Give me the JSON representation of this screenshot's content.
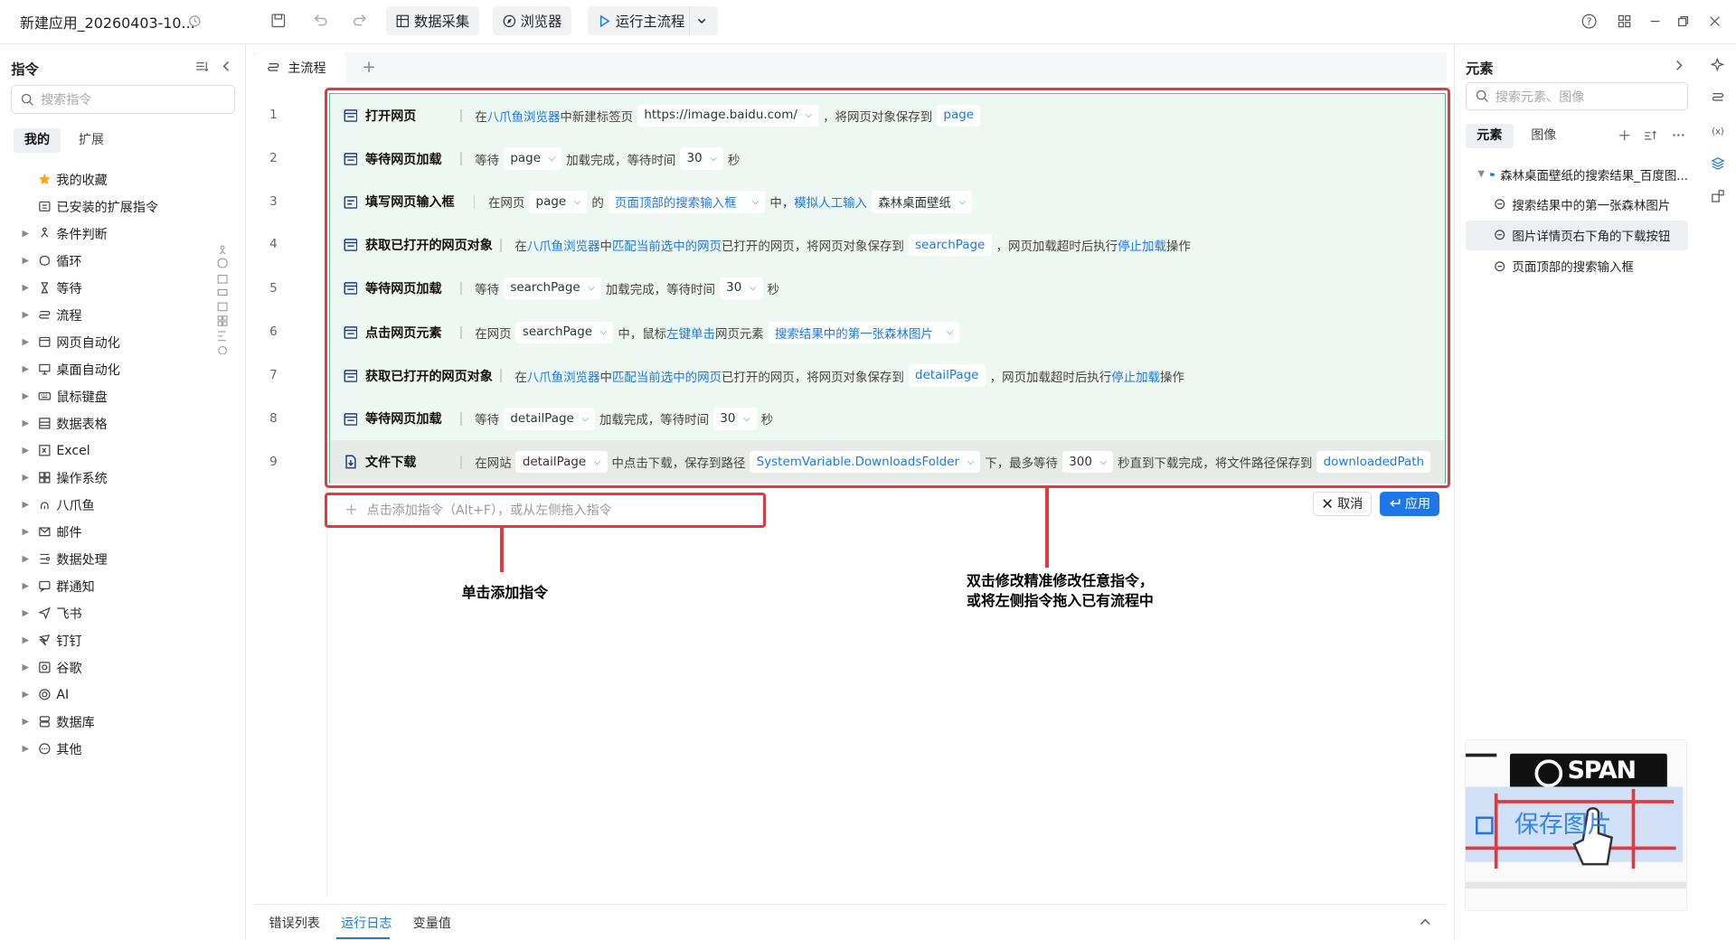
{
  "app": {
    "title": "新建应用_20260403-10..."
  },
  "toolbar": {
    "data_collect": "数据采集",
    "browser": "浏览器",
    "run": "运行主流程"
  },
  "left": {
    "title": "指令",
    "search_placeholder": "搜索指令",
    "tabs": [
      "我的",
      "扩展"
    ],
    "tree": [
      "我的收藏",
      "已安装的扩展指令",
      "条件判断",
      "循环",
      "等待",
      "流程",
      "网页自动化",
      "桌面自动化",
      "鼠标键盘",
      "数据表格",
      "Excel",
      "操作系统",
      "八爪鱼",
      "邮件",
      "数据处理",
      "群通知",
      "飞书",
      "钉钉",
      "谷歌",
      "AI",
      "数据库",
      "其他"
    ]
  },
  "tab": {
    "main": "主流程",
    "add": "+"
  },
  "lines": [
    "1",
    "2",
    "3",
    "4",
    "5",
    "6",
    "7",
    "8",
    "9"
  ],
  "rows": [
    {
      "cmd": "打开网页",
      "t1": "在",
      "l1": "八爪鱼浏览器",
      "t2": "中新建标签页",
      "c1": "https://image.baidu.com/",
      "t3": "，将网页对象保存到",
      "v1": "page"
    },
    {
      "cmd": "等待网页加载",
      "t1": "等待",
      "c1": "page",
      "t2": "加载完成，等待时间",
      "c2": "30",
      "t3": "秒"
    },
    {
      "cmd": "填写网页输入框",
      "t1": "在网页",
      "c1": "page",
      "t2": "的",
      "v1": "页面顶部的搜索输入框",
      "t3": "中，",
      "l1": "模拟人工输入",
      "c2": "森林桌面壁纸"
    },
    {
      "cmd": "获取已打开的网页对象",
      "t1": "在",
      "l1": "八爪鱼浏览器",
      "t2": "中",
      "l2": "匹配当前选中的网页",
      "t3": "已打开的网页，将网页对象保存到",
      "v1": "searchPage",
      "t4": "，网页加载超时后执行",
      "l3": "停止加载",
      "t5": "操作"
    },
    {
      "cmd": "等待网页加载",
      "t1": "等待",
      "c1": "searchPage",
      "t2": "加载完成，等待时间",
      "c2": "30",
      "t3": "秒"
    },
    {
      "cmd": "点击网页元素",
      "t1": "在网页",
      "c1": "searchPage",
      "t2": "中，鼠标",
      "l1": "左键单击",
      "t3": "网页元素",
      "v1": "搜索结果中的第一张森林图片"
    },
    {
      "cmd": "获取已打开的网页对象",
      "t1": "在",
      "l1": "八爪鱼浏览器",
      "t2": "中",
      "l2": "匹配当前选中的网页",
      "t3": "已打开的网页，将网页对象保存到",
      "v1": "detailPage",
      "t4": "，网页加载超时后执行",
      "l3": "停止加载",
      "t5": "操作"
    },
    {
      "cmd": "等待网页加载",
      "t1": "等待",
      "c1": "detailPage",
      "t2": "加载完成，等待时间",
      "c2": "30",
      "t3": "秒"
    },
    {
      "cmd": "文件下载",
      "t1": "在网站",
      "c1": "detailPage",
      "t2": "中点击下载，保存到路径",
      "v1": "SystemVariable.DownloadsFolder",
      "t3": "下，最多等待",
      "c2": "300",
      "t4": "秒直到下载完成，将文件路径保存到",
      "v2": "downloadedPath"
    }
  ],
  "add_hint": "点击添加指令（Alt+F），或从左侧拖入指令",
  "buttons": {
    "cancel": "取消",
    "apply": "应用"
  },
  "annotations": {
    "a1": "单击添加指令",
    "a2_l1": "双击修改精准修改任意指令，",
    "a2_l2": "或将左侧指令拖入已有流程中"
  },
  "bottom_tabs": [
    "错误列表",
    "运行日志",
    "变量值"
  ],
  "right": {
    "title": "元素",
    "search_placeholder": "搜索元素、图像",
    "tabs": [
      "元素",
      "图像"
    ],
    "folder": "森林桌面壁纸的搜索结果_百度图...",
    "items": [
      "搜索结果中的第一张森林图片",
      "图片详情页右下角的下载按钮",
      "页面顶部的搜索输入框"
    ],
    "preview": {
      "badge": "SPAN",
      "text": "保存图片"
    }
  },
  "colors": {
    "accent": "#1e76e8",
    "highlight": "#e3393d",
    "flow_border": "#4fbf85",
    "flow_bg": "#eef8f2"
  }
}
